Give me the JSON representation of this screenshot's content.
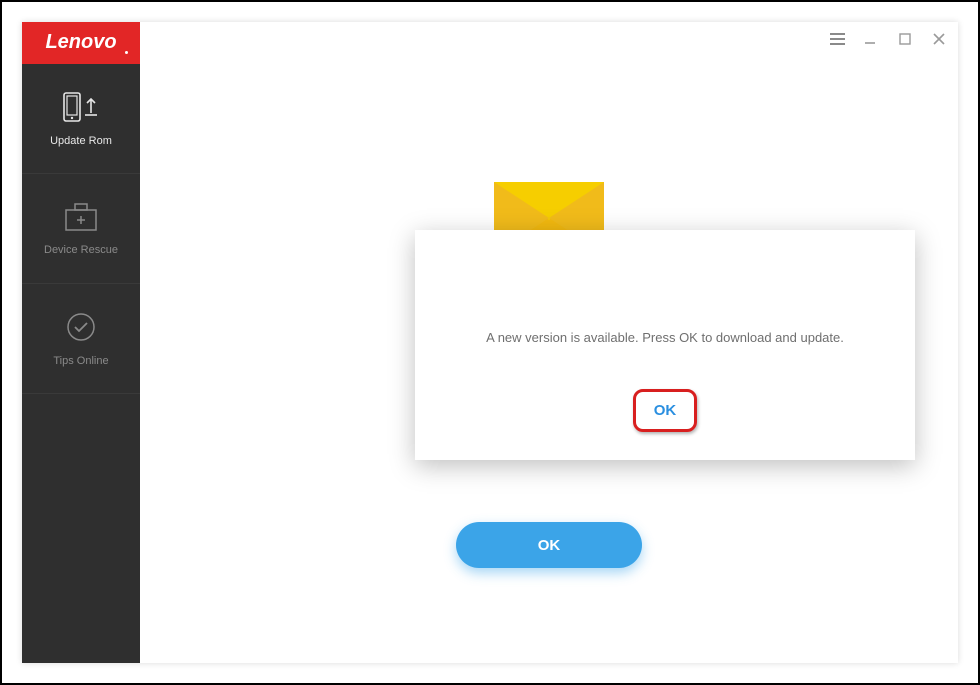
{
  "logo": "Lenovo",
  "sidebar": {
    "items": [
      {
        "label": "Update Rom"
      },
      {
        "label": "Device Rescue"
      },
      {
        "label": "Tips Online"
      }
    ]
  },
  "dialog": {
    "message": "A new version is available. Press OK to download and update.",
    "ok_label": "OK"
  },
  "main_button": {
    "ok_label": "OK"
  }
}
